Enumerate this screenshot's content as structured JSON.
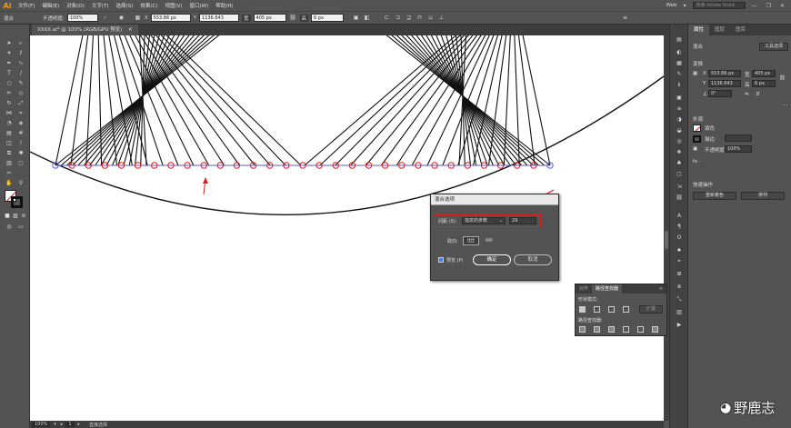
{
  "app": {
    "logo": "Ai"
  },
  "menu": {
    "items": [
      "文件(F)",
      "编辑(E)",
      "对象(O)",
      "文字(T)",
      "选择(S)",
      "效果(C)",
      "视图(V)",
      "窗口(W)",
      "帮助(H)"
    ]
  },
  "workspace": {
    "label": "Web",
    "search_placeholder": "搜索 Adobe Stock"
  },
  "window_controls": {
    "minimize": "—",
    "restore": "❐",
    "close": "✕"
  },
  "control_bar": {
    "mode": "混合",
    "opacity_label": "不透明度:",
    "opacity_value": "100%",
    "x_label": "X",
    "x_value": "553.86 px",
    "y_label": "Y",
    "y_value": "1136.643",
    "w_label": "宽",
    "w_value": "405 px",
    "h_label": "高",
    "h_value": "6 px"
  },
  "document": {
    "tab": "XXXX.ai* @ 100% (RGB/GPU 预览)",
    "close": "✕"
  },
  "status": {
    "zoom": "100%",
    "page": "1",
    "tool": "直接选择"
  },
  "properties_panel": {
    "tabs": [
      "属性",
      "图层",
      "图库"
    ],
    "sel_type": "混合",
    "tool_options_button": "工具选项",
    "transform_title": "变换",
    "x": "553.86 px",
    "w": "405 px",
    "y": "1136.643",
    "h": "6 px",
    "angle": "0°",
    "appearance_title": "外观",
    "fill_label": "填色",
    "stroke_label": "描边",
    "opacity_label": "不透明度",
    "opacity_value": "100%",
    "fx": "fx.",
    "quick_actions_title": "快速操作",
    "recolor_button": "重新着色",
    "arrange_button": "排列"
  },
  "blend_dialog": {
    "title": "混合选项",
    "spacing_label": "间距 (S):",
    "spacing_mode": "指定的步数",
    "steps": "29",
    "orientation_label": "取向:",
    "preview_label": "预览 (P)",
    "ok_button": "确定",
    "cancel_button": "取消"
  },
  "pathfinder_panel": {
    "tabs": [
      "对齐",
      "路径查找器"
    ],
    "shape_modes_label": "形状模式:",
    "expand_button": "扩展",
    "pathfinders_label": "路径查找器:"
  },
  "watermark": {
    "text": "野鹿志"
  },
  "colors": {
    "canvas": "#ffffff",
    "ui_bg": "#535353",
    "annotation": "#e21b1b",
    "anchor_red": "#e21b1b",
    "anchor_blue": "#5a5ae0",
    "accent_logo": "#ff9a00"
  }
}
